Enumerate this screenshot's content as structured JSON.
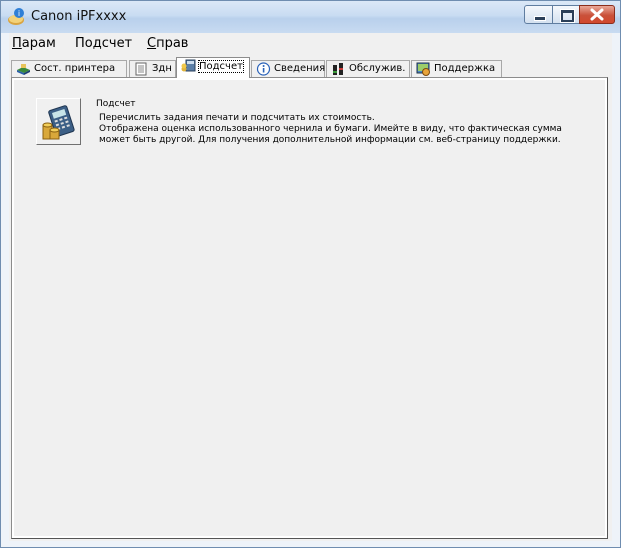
{
  "window": {
    "title": "Canon iPFxxxx"
  },
  "menu": {
    "items": [
      {
        "label_acc": "П",
        "label_rest": "арам"
      },
      {
        "label_pre": "По",
        "label_acc": "д",
        "label_rest": "счет"
      },
      {
        "label_acc": "С",
        "label_rest": "прав"
      }
    ]
  },
  "tabs": [
    {
      "label": "Сост. принтера",
      "icon": "printer-status-icon",
      "active": false
    },
    {
      "label": "Здн",
      "icon": "jobs-icon",
      "active": false
    },
    {
      "label": "Подсчет",
      "icon": "accounting-icon",
      "active": true
    },
    {
      "label": "Сведения",
      "icon": "info-icon",
      "active": false
    },
    {
      "label": "Обслужив.",
      "icon": "maintenance-icon",
      "active": false
    },
    {
      "label": "Поддержка",
      "icon": "support-icon",
      "active": false
    }
  ],
  "accounting": {
    "title": "Подсчет",
    "button_icon": "accounting-calculator-icon",
    "lines": [
      "Перечислить задания печати и подсчитать их стоимость.",
      "Отображена оценка использованного чернила и бумаги. Имейте в виду, что фактическая сумма",
      "может быть другой. Для получения дополнительной информации см. веб-страницу поддержки."
    ]
  },
  "colors": {
    "titlebar": "#c9dcf2",
    "close_button": "#c9513a",
    "client": "#f0f0f0"
  }
}
